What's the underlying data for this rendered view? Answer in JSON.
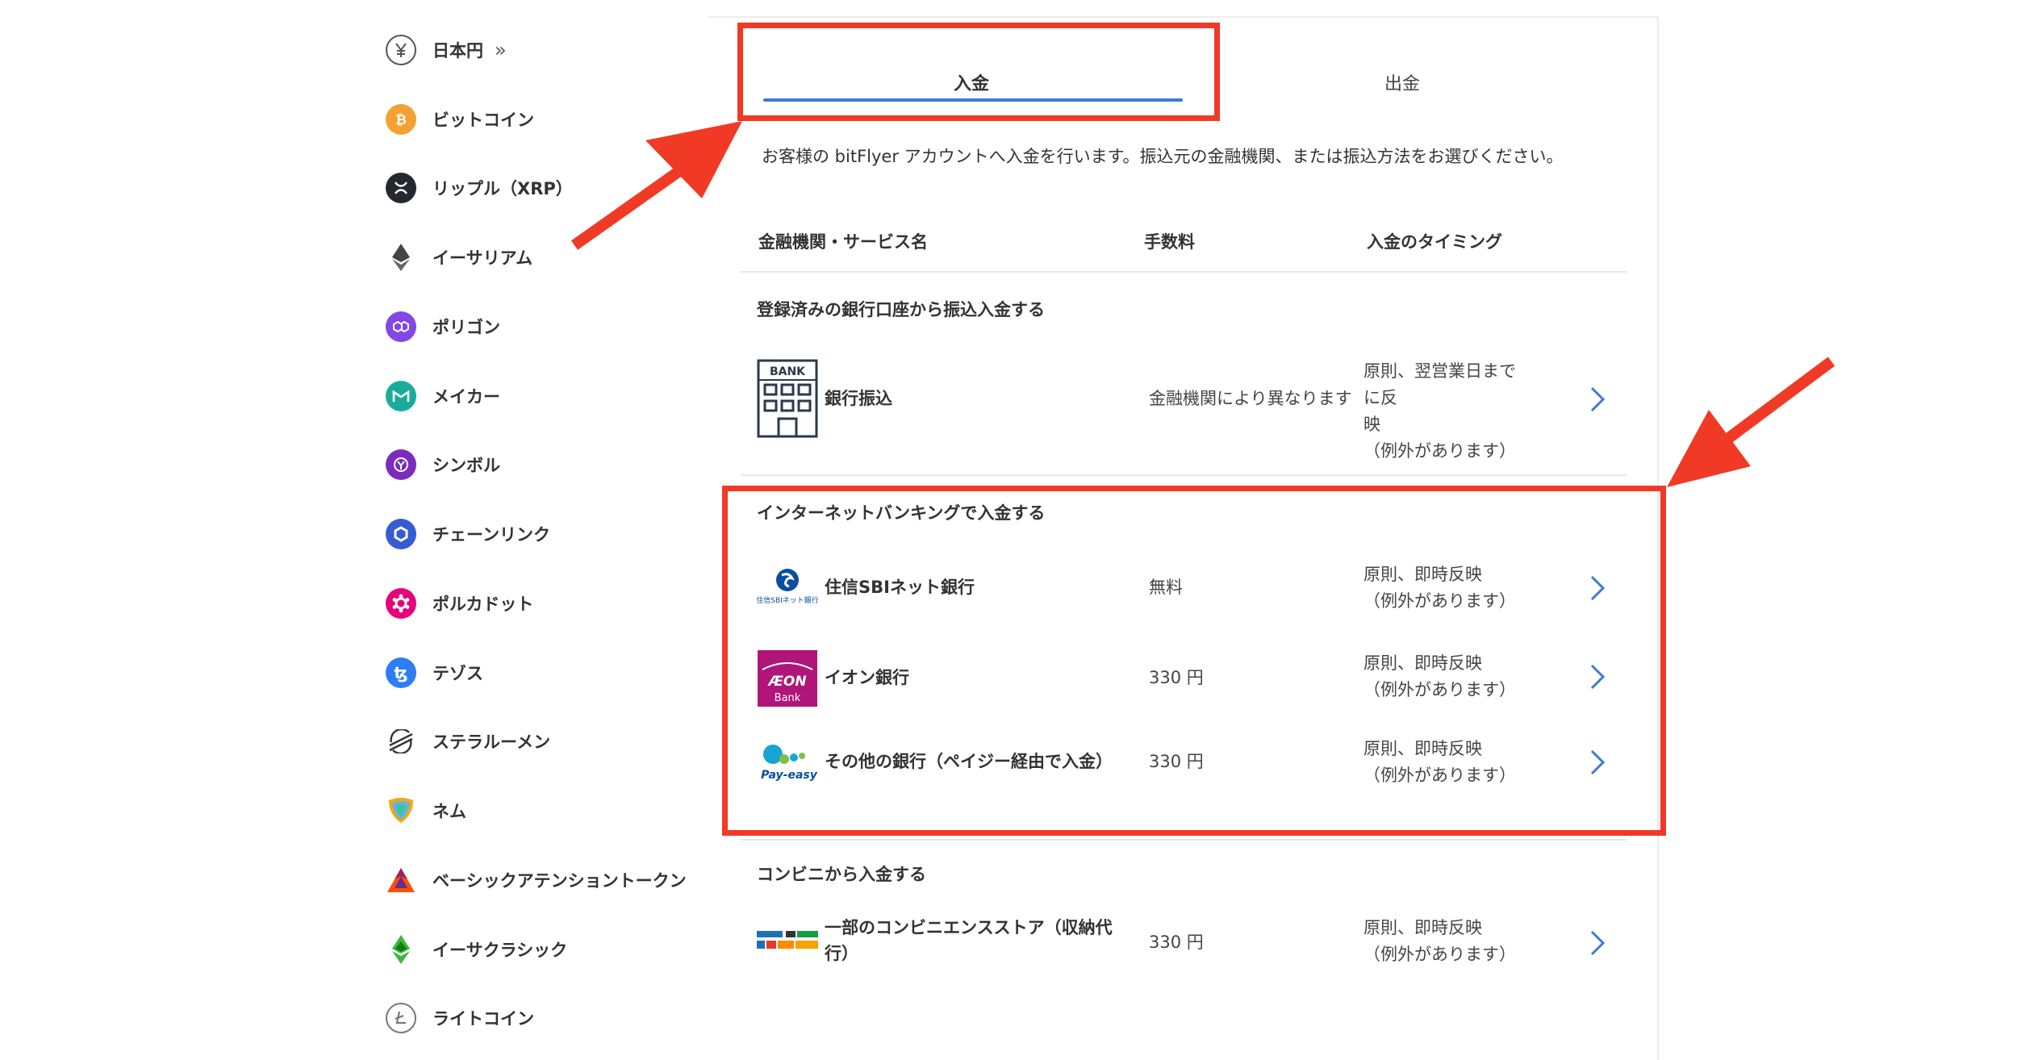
{
  "sidebar": {
    "items": [
      {
        "label": "日本円",
        "icon": "yen-icon",
        "active": true
      },
      {
        "label": "ビットコイン",
        "icon": "bitcoin-icon"
      },
      {
        "label": "リップル（XRP）",
        "icon": "xrp-icon"
      },
      {
        "label": "イーサリアム",
        "icon": "ethereum-icon"
      },
      {
        "label": "ポリゴン",
        "icon": "polygon-icon"
      },
      {
        "label": "メイカー",
        "icon": "maker-icon"
      },
      {
        "label": "シンボル",
        "icon": "symbol-icon"
      },
      {
        "label": "チェーンリンク",
        "icon": "chainlink-icon"
      },
      {
        "label": "ポルカドット",
        "icon": "polkadot-icon"
      },
      {
        "label": "テゾス",
        "icon": "tezos-icon"
      },
      {
        "label": "ステラルーメン",
        "icon": "stellar-icon"
      },
      {
        "label": "ネム",
        "icon": "nem-icon"
      },
      {
        "label": "ベーシックアテンショントークン",
        "icon": "bat-icon"
      },
      {
        "label": "イーサクラシック",
        "icon": "ethereum-classic-icon"
      },
      {
        "label": "ライトコイン",
        "icon": "litecoin-icon"
      }
    ],
    "active_marker": "»"
  },
  "tabs": {
    "deposit": "入金",
    "withdraw": "出金"
  },
  "description": "お客様の bitFlyer アカウントへ入金を行います。振込元の金融機関、または振込方法をお選びください。",
  "table_headers": {
    "name": "金融機関・サービス名",
    "fee": "手数料",
    "timing": "入金のタイミング"
  },
  "sections": [
    {
      "title": "登録済みの銀行口座から振込入金する",
      "rows": [
        {
          "name": "銀行振込",
          "fee": "金融機関により異なります",
          "timing_lines": [
            "原則、翌営業日までに反",
            "映",
            "（例外があります）"
          ],
          "logo": "bank-building-icon",
          "logo_text": "BANK"
        }
      ]
    },
    {
      "title": "インターネットバンキングで入金する",
      "rows": [
        {
          "name": "住信SBIネット銀行",
          "fee": "無料",
          "timing_lines": [
            "原則、即時反映",
            "（例外があります）"
          ],
          "logo": "sbi-bank-logo",
          "logo_text": "住信SBIネット銀行"
        },
        {
          "name": "イオン銀行",
          "fee": "330 円",
          "timing_lines": [
            "原則、即時反映",
            "（例外があります）"
          ],
          "logo": "aeon-bank-logo",
          "logo_text": "Bank"
        },
        {
          "name": "その他の銀行（ペイジー経由で入金）",
          "fee": "330 円",
          "timing_lines": [
            "原則、即時反映",
            "（例外があります）"
          ],
          "logo": "pay-easy-logo",
          "logo_text": "Pay-easy"
        }
      ]
    },
    {
      "title": "コンビニから入金する",
      "rows": [
        {
          "name_lines": [
            "一部のコンビニエンスストア（収納代",
            "行）"
          ],
          "fee": "330 円",
          "timing_lines": [
            "原則、即時反映",
            "（例外があります）"
          ],
          "logo": "convenience-store-logos"
        }
      ]
    }
  ],
  "colors": {
    "accent": "#3d7ad6",
    "annotation": "#f03a26",
    "text": "#333333"
  }
}
